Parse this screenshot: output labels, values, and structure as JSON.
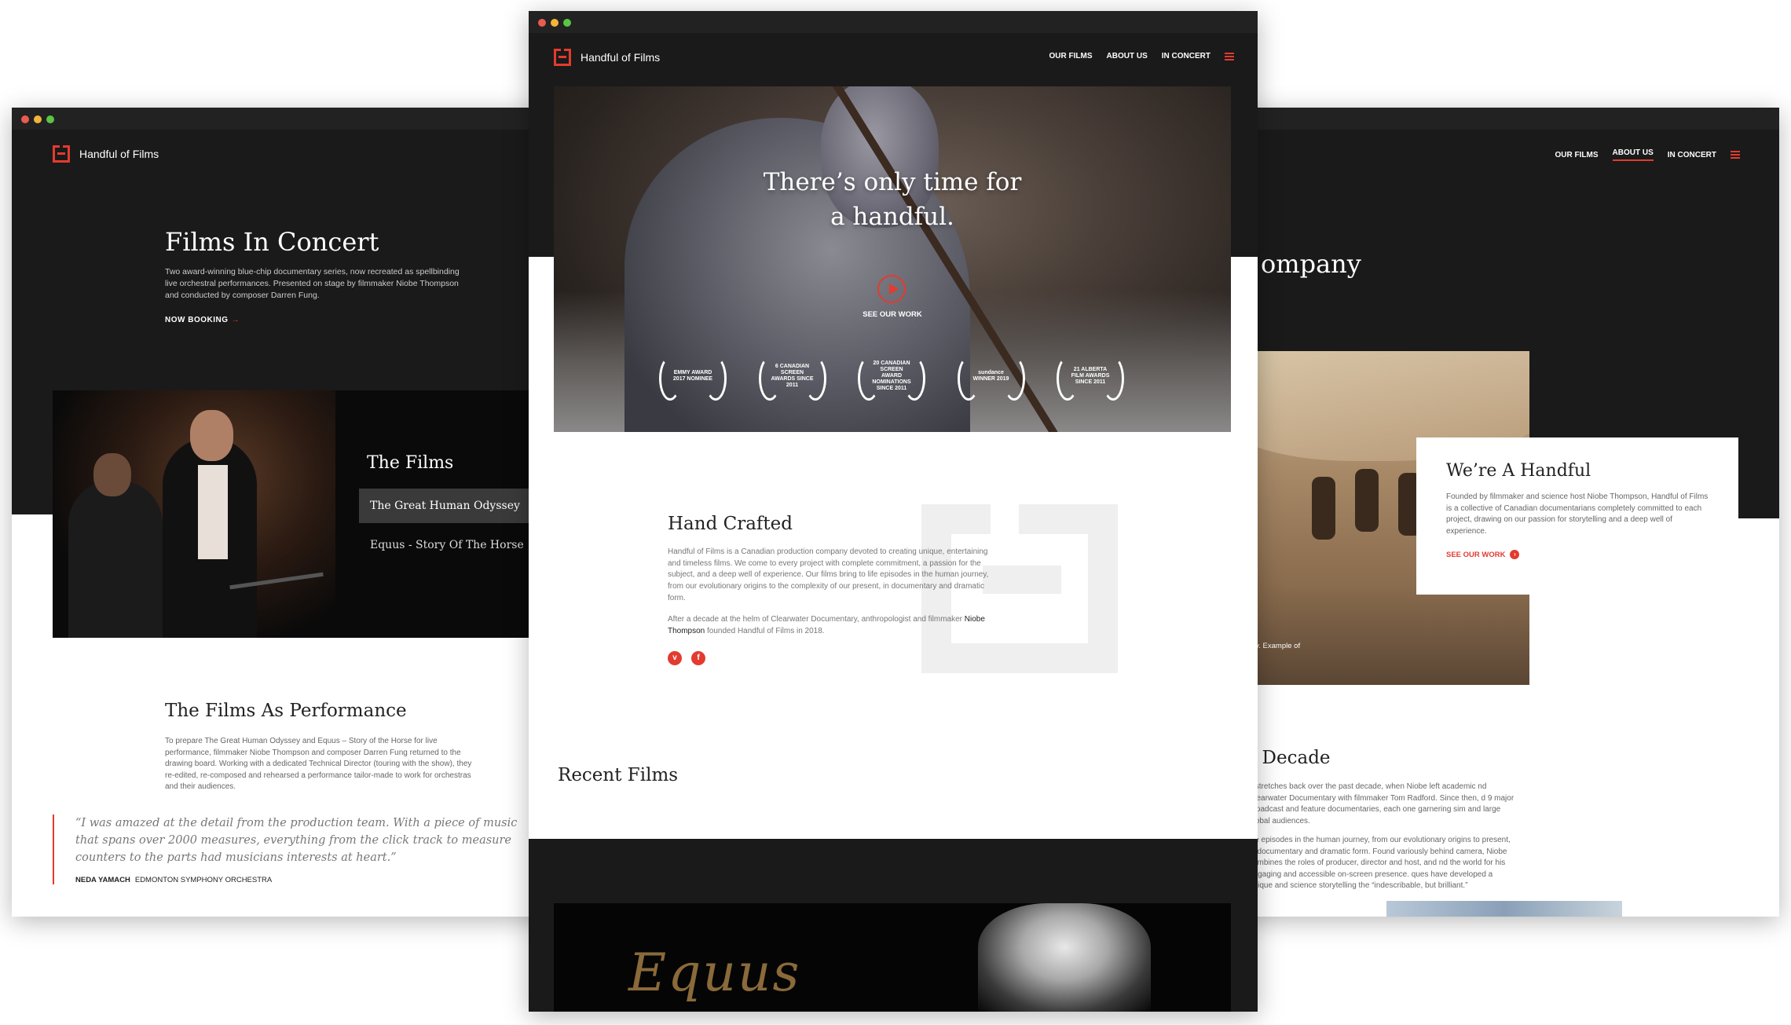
{
  "brand": {
    "name": "Handful of Films",
    "accent": "#e33b2f",
    "dark_bg": "#1a1a1a"
  },
  "nav": {
    "items": [
      "OUR FILMS",
      "ABOUT US",
      "IN CONCERT"
    ],
    "menu_icon": "hamburger-icon"
  },
  "left": {
    "title": "Films In Concert",
    "lead": "Two award-winning blue-chip documentary series, now recreated as spellbinding live orchestral performances. Presented on stage by filmmaker Niobe Thompson and conducted by composer Darren Fung.",
    "cta": "NOW BOOKING",
    "films_title": "The Films",
    "films": [
      "The Great Human Odyssey",
      "Equus - Story Of The Horse"
    ],
    "performance_title": "The Films As Performance",
    "performance_text": "To prepare The Great Human Odyssey and Equus – Story of the Horse for live performance, filmmaker Niobe Thompson and composer Darren Fung returned to the drawing board. Working with a dedicated Technical Director (touring with the show), they re-edited, re-composed and rehearsed a performance tailor-made to work for orchestras and their audiences.",
    "quote": "“I was amazed at the detail from the production team. With a piece of music that spans over 2000 measures, everything from the click track to measure counters to the parts had musicians interests at heart.”",
    "quote_name": "NEDA YAMACH",
    "quote_org": "EDMONTON SYMPHONY ORCHESTRA"
  },
  "center": {
    "hero_line1": "There’s only time for",
    "hero_line2": "a handful.",
    "hero_cta": "SEE OUR WORK",
    "awards": [
      "EMMY AWARD 2017 NOMINEE",
      "6 CANADIAN SCREEN AWARDS SINCE 2011",
      "20 CANADIAN SCREEN AWARD NOMINATIONS SINCE 2011",
      "sundance WINNER 2019",
      "21 ALBERTA FILM AWARDS SINCE 2011"
    ],
    "hc_title": "Hand Crafted",
    "hc_p1": "Handful of Films is a Canadian production company devoted to creating unique, entertaining and timeless films. We come to every project with complete commitment, a passion for the subject, and a deep well of experience. Our films bring to life episodes in the human journey, from our evolutionary origins to the complexity of our present, in documentary and dramatic form.",
    "hc_p2_a": "After a decade at the helm of Clearwater Documentary, anthropologist and filmmaker",
    "hc_p2_name": "Niobe Thompson",
    "hc_p2_b": "founded Handful of Films in 2018.",
    "social": [
      "v",
      "f"
    ],
    "recent_title": "Recent Films",
    "banner_word": "Equus"
  },
  "right": {
    "company_fragment": "ompany",
    "card_title": "We’re A Handful",
    "card_text": "Founded by filmmaker and science host Niobe Thompson, Handful of Films is a collective of Canadian documentarians completely committed to each project, drawing on our passion for storytelling and a deep well of experience.",
    "card_cta": "SEE OUR WORK",
    "photo_caption": "gallery. Example of",
    "decade_fragment": "t Decade",
    "decade_p1": "y stretches back over the past decade, when Niobe left academic nd Clearwater Documentary with filmmaker Tom Radford. Since then, d 9 major broadcast and feature documentaries, each one garnering sim and large global audiences.",
    "decade_p2": "life episodes in the human journey, from our evolutionary origins to present, in documentary and dramatic form. Found variously behind camera, Niobe combines the roles of producer, director and host, and nd the world for his engaging and accessible on-screen presence. ques have developed a unique and science storytelling the “indescribable, but brilliant.”"
  }
}
